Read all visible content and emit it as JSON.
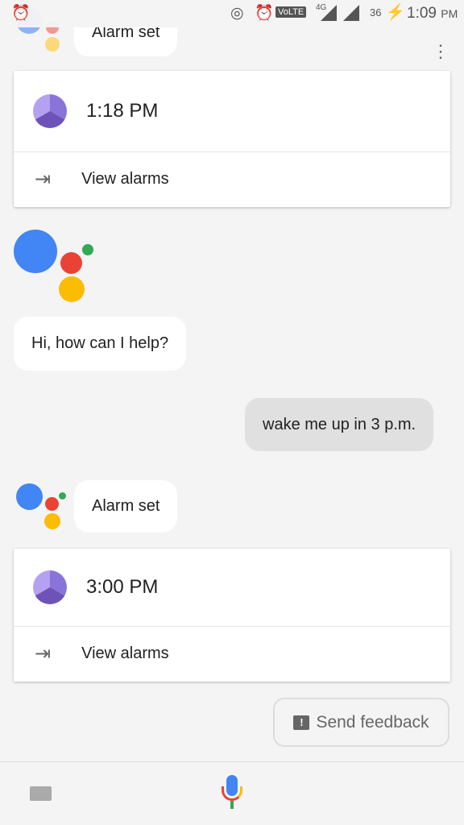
{
  "status_bar": {
    "time": "1:09",
    "ampm": "PM",
    "network": "4G",
    "volte": "VoLTE",
    "battery": "36"
  },
  "conversation": {
    "top_reply": "Alarm set",
    "card1": {
      "time": "1:18 PM",
      "action": "View alarms"
    },
    "greeting": "Hi, how can I help?",
    "user_message": "wake me up in 3 p.m.",
    "reply": "Alarm set",
    "card2": {
      "time": "3:00 PM",
      "action": "View alarms"
    }
  },
  "feedback_label": "Send feedback",
  "colors": {
    "blue": "#4285f4",
    "red": "#ea4335",
    "yellow": "#fbbc05",
    "green": "#34a853",
    "alarm_purple": "#7e63cf"
  }
}
